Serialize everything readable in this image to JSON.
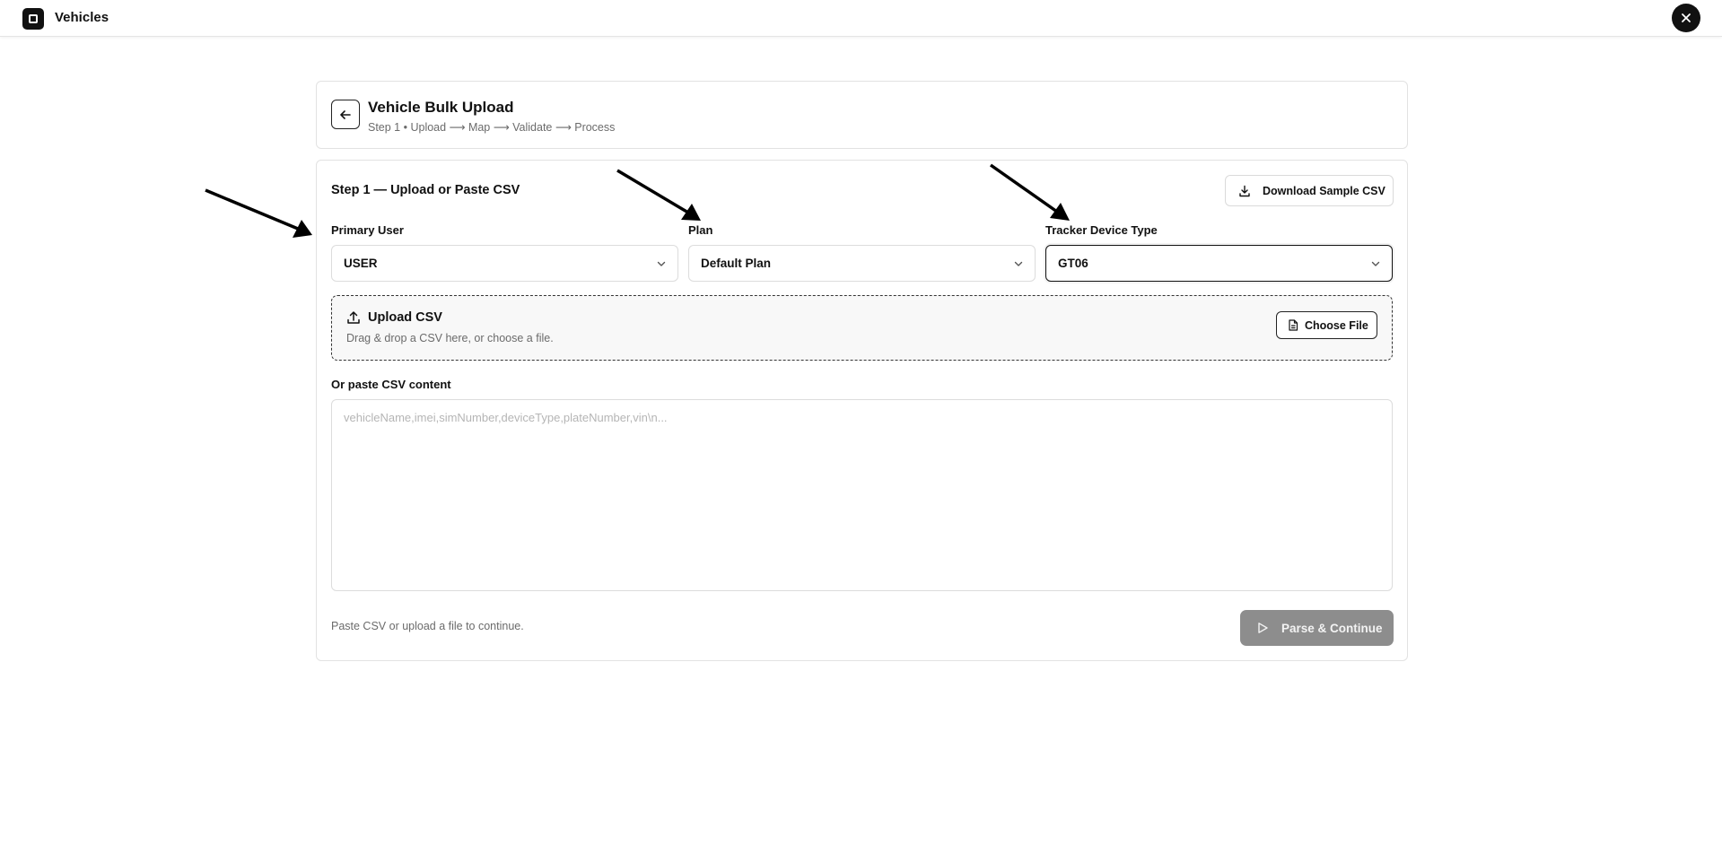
{
  "app": {
    "title": "Vehicles",
    "logo_icon": "square-logo-icon",
    "close_icon": "close-icon"
  },
  "header": {
    "title": "Vehicle Bulk Upload",
    "subtitle": "Step 1 • Upload ⟶ Map ⟶ Validate ⟶ Process",
    "back_icon": "arrow-left-icon"
  },
  "step": {
    "title": "Step 1 — Upload or Paste CSV",
    "download_label": "Download Sample CSV",
    "download_icon": "download-icon"
  },
  "fields": {
    "primary_user": {
      "label": "Primary User",
      "value": "USER"
    },
    "plan": {
      "label": "Plan",
      "value": "Default Plan"
    },
    "tracker": {
      "label": "Tracker Device Type",
      "value": "GT06"
    }
  },
  "upload": {
    "title": "Upload CSV",
    "subtitle": "Drag & drop a CSV here, or choose a file.",
    "choose_label": "Choose File",
    "upload_icon": "upload-icon",
    "file_icon": "file-icon"
  },
  "paste": {
    "label": "Or paste CSV content",
    "placeholder": "vehicleName,imei,simNumber,deviceType,plateNumber,vin\\n...",
    "value": ""
  },
  "footer": {
    "hint": "Paste CSV or upload a file to continue.",
    "parse_label": "Parse & Continue",
    "parse_icon": "play-icon",
    "parse_disabled": true
  },
  "colors": {
    "accent": "#111111",
    "disabled": "#8d8d8d",
    "muted_text": "#6b6b6b",
    "border": "#e2e2e2"
  }
}
